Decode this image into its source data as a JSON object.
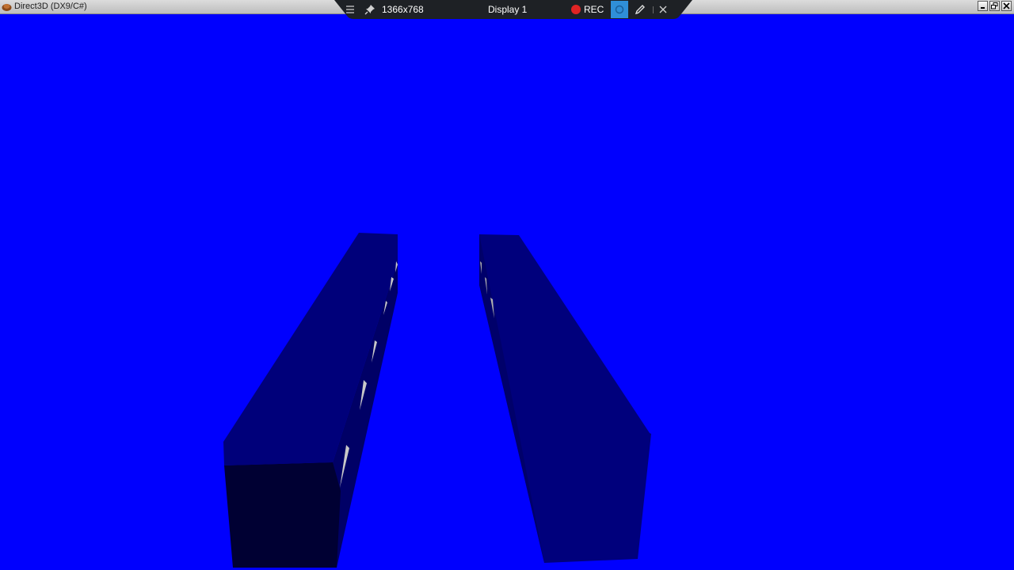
{
  "window": {
    "title": "Direct3D (DX9/C#)",
    "controls": [
      "minimize",
      "restore",
      "close"
    ]
  },
  "recording_toolbar": {
    "menu_icon": "hamburger-menu-icon",
    "pin_icon": "pin-icon",
    "resolution": "1366x768",
    "display": "Display 1",
    "rec_label": "REC",
    "camera_icon": "camera-icon",
    "pen_icon": "pen-icon",
    "close_icon": "close-icon"
  },
  "scene": {
    "background_color": "#0000fe",
    "objects": [
      {
        "name": "left-wall-block",
        "top_color": "#00007a",
        "front_color": "#000033",
        "side_color": "#000066"
      },
      {
        "name": "right-wall-block",
        "top_color": "#00007c",
        "side_color": "#00006a"
      }
    ]
  },
  "colors": {
    "rec": "#e02424",
    "active_button": "#2f8fd8",
    "toolbar_bg": "#1e2125"
  }
}
